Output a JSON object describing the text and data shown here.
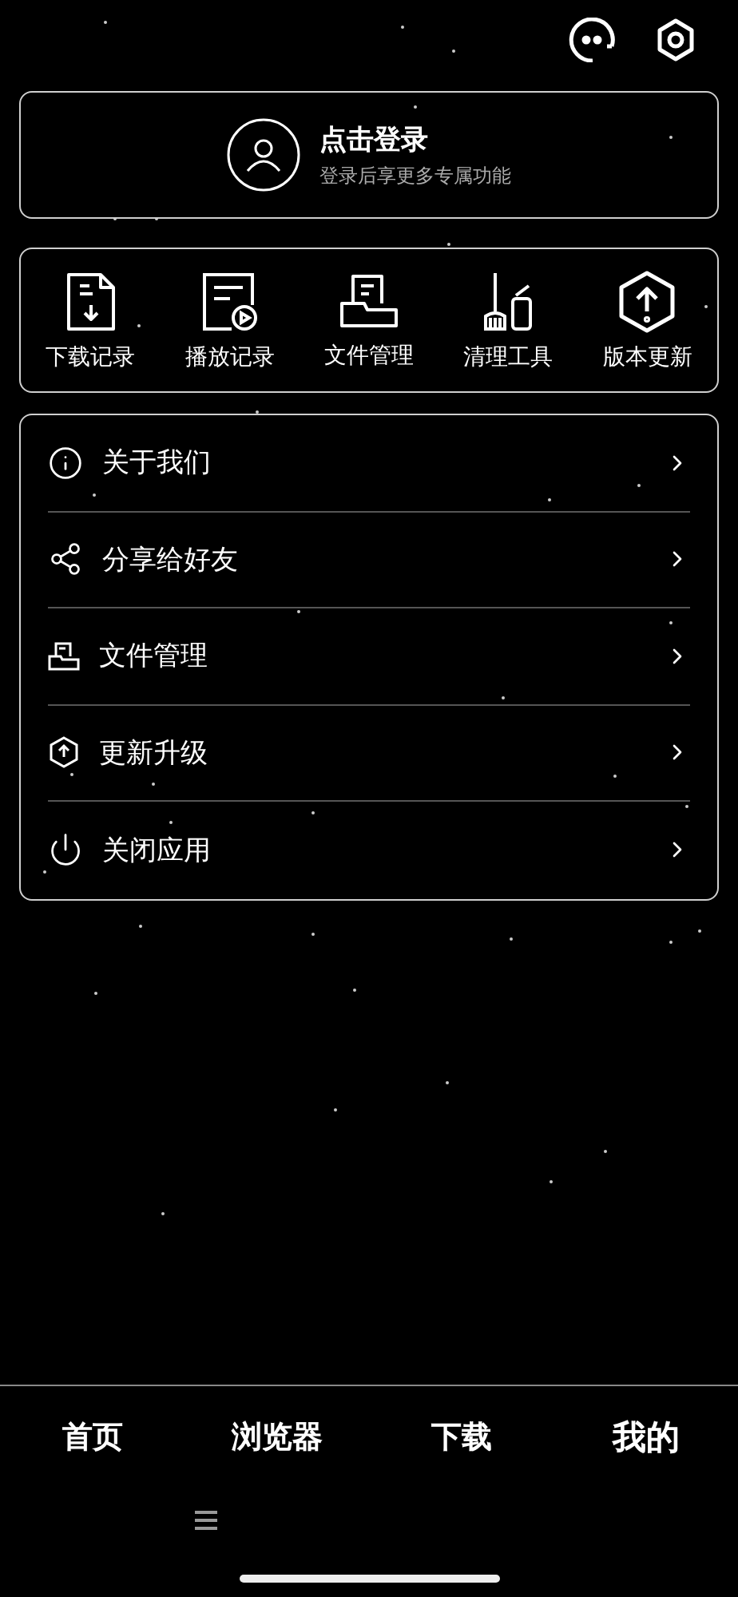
{
  "login": {
    "title": "点击登录",
    "subtitle": "登录后享更多专属功能"
  },
  "tools": [
    {
      "label": "下载记录"
    },
    {
      "label": "播放记录"
    },
    {
      "label": "文件管理"
    },
    {
      "label": "清理工具"
    },
    {
      "label": "版本更新"
    }
  ],
  "menu": [
    {
      "label": "关于我们"
    },
    {
      "label": "分享给好友"
    },
    {
      "label": "文件管理"
    },
    {
      "label": "更新升级"
    },
    {
      "label": "关闭应用"
    }
  ],
  "tabs": [
    {
      "label": "首页",
      "selected": false
    },
    {
      "label": "浏览器",
      "selected": false
    },
    {
      "label": "下载",
      "selected": false
    },
    {
      "label": "我的",
      "selected": true
    }
  ]
}
